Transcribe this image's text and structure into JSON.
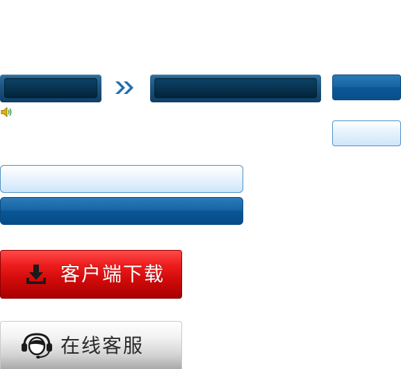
{
  "top_row": {
    "field_1_value": "",
    "field_2_value": "",
    "primary_button_label": ""
  },
  "secondary_button_label": "",
  "wide_bars": {
    "light_label": "",
    "dark_label": ""
  },
  "download_button": {
    "label": "客户端下载",
    "icon": "download-icon"
  },
  "service_button": {
    "label": "在线客服",
    "icon": "headset-agent-icon"
  },
  "icons": {
    "speaker": "speaker-icon",
    "chevron": "double-chevron-right-icon"
  },
  "colors": {
    "dark_blue": "#0f3f66",
    "blue": "#1766a5",
    "light_blue": "#cfe6fa",
    "red": "#d20b0b",
    "grey": "#d4d4d4"
  }
}
